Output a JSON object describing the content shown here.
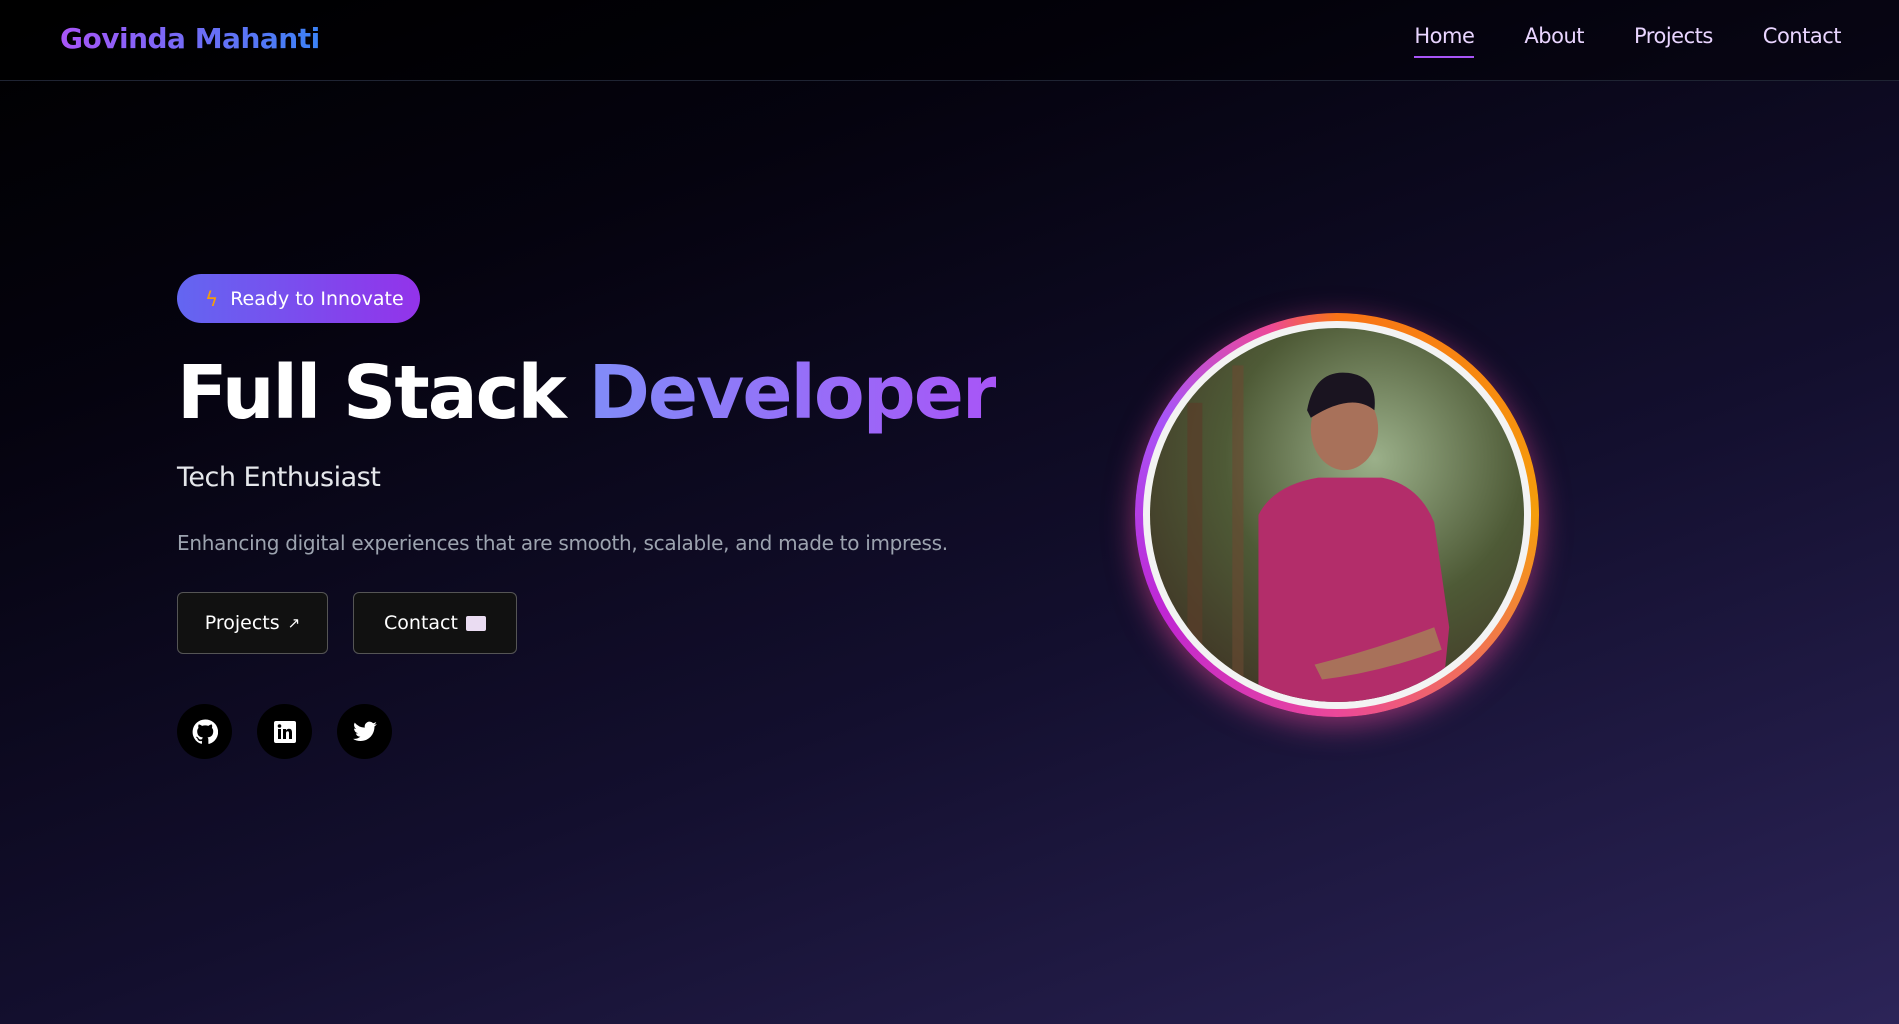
{
  "nav": {
    "logo": "Govinda Mahanti",
    "links": [
      {
        "label": "Home",
        "active": true
      },
      {
        "label": "About"
      },
      {
        "label": "Projects"
      },
      {
        "label": "Contact"
      }
    ]
  },
  "hero": {
    "badge": {
      "icon": "lightning-icon",
      "label": "Ready to Innovate"
    },
    "title_plain": "Full Stack ",
    "title_accent": "Developer",
    "subtitle": "Tech Enthusiast",
    "description": "Enhancing digital experiences that are smooth, scalable, and made to impress.",
    "buttons": [
      {
        "label": "Projects",
        "icon": "↗"
      },
      {
        "label": "Contact",
        "icon": "✉"
      }
    ],
    "social": [
      {
        "icon": "github-icon"
      },
      {
        "icon": "linkedin-icon"
      },
      {
        "icon": "twitter-icon"
      }
    ]
  },
  "colors": {
    "accent": "#a855f7",
    "blue": "#3b82f6",
    "badge_start": "#6366f1",
    "badge_end": "#9333ea"
  }
}
